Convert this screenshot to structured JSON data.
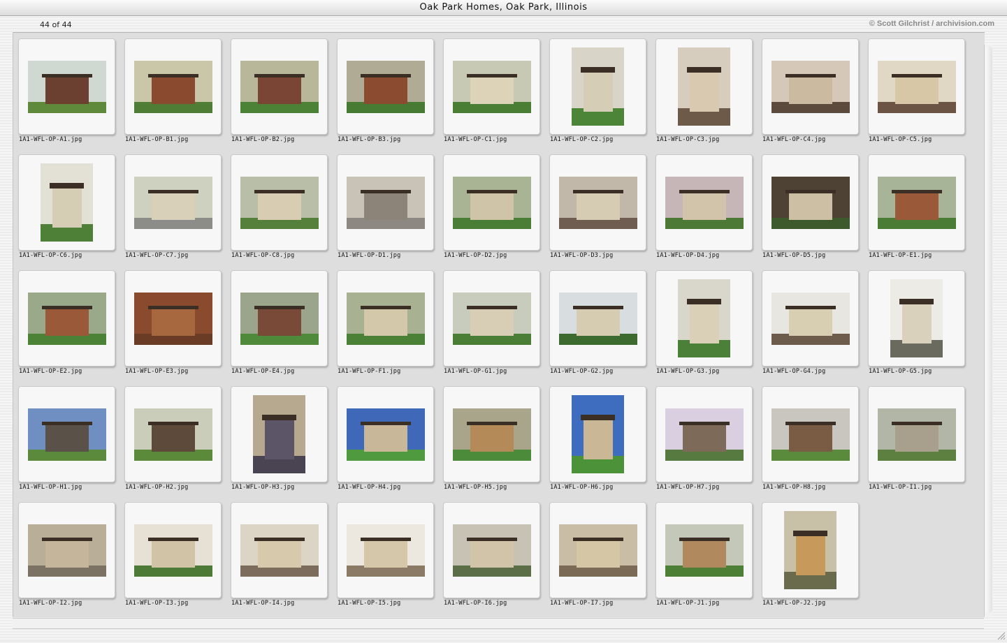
{
  "window": {
    "title": "Oak Park Homes, Oak Park, Illinois"
  },
  "header": {
    "count": "44 of 44",
    "credit": "© Scott Gilchrist / archivision.com"
  },
  "rows": [
    [
      {
        "file": "1A1-WFL-OP-A1.jpg",
        "orient": "landscape",
        "sky": "#cfd9d2",
        "wall": "#6b4030",
        "lawn": "#5f8a3b"
      },
      {
        "file": "1A1-WFL-OP-B1.jpg",
        "orient": "landscape",
        "sky": "#c9c7a8",
        "wall": "#8a4a30",
        "lawn": "#4f7d35"
      },
      {
        "file": "1A1-WFL-OP-B2.jpg",
        "orient": "landscape",
        "sky": "#b8b79a",
        "wall": "#7a4535",
        "lawn": "#4c8236"
      },
      {
        "file": "1A1-WFL-OP-B3.jpg",
        "orient": "landscape",
        "sky": "#b0ab94",
        "wall": "#8a4b30",
        "lawn": "#477a32"
      },
      {
        "file": "1A1-WFL-OP-C1.jpg",
        "orient": "landscape",
        "sky": "#c7c9b5",
        "wall": "#ddd3b8",
        "lawn": "#4a7e35"
      },
      {
        "file": "1A1-WFL-OP-C2.jpg",
        "orient": "portrait",
        "sky": "#d8d4c8",
        "wall": "#d5cdb6",
        "lawn": "#4c8538"
      },
      {
        "file": "1A1-WFL-OP-C3.jpg",
        "orient": "portrait",
        "sky": "#d6cdbf",
        "wall": "#d9c9b0",
        "lawn": "#6e5a48"
      },
      {
        "file": "1A1-WFL-OP-C4.jpg",
        "orient": "landscape",
        "sky": "#d5c8b8",
        "wall": "#cbb9a0",
        "lawn": "#5c4a3c"
      },
      {
        "file": "1A1-WFL-OP-C5.jpg",
        "orient": "landscape",
        "sky": "#e0d7c4",
        "wall": "#d8c7a6",
        "lawn": "#6b5444"
      }
    ],
    [
      {
        "file": "1A1-WFL-OP-C6.jpg",
        "orient": "portrait",
        "sky": "#e3e0d6",
        "wall": "#d6cdb5",
        "lawn": "#4f8038"
      },
      {
        "file": "1A1-WFL-OP-C7.jpg",
        "orient": "landscape",
        "sky": "#cfd1c0",
        "wall": "#d9d0ba",
        "lawn": "#8c8c88"
      },
      {
        "file": "1A1-WFL-OP-C8.jpg",
        "orient": "landscape",
        "sky": "#b9bea8",
        "wall": "#d8cdb2",
        "lawn": "#54803c"
      },
      {
        "file": "1A1-WFL-OP-D1.jpg",
        "orient": "landscape",
        "sky": "#c8c3b6",
        "wall": "#8c8478",
        "lawn": "#8d8982"
      },
      {
        "file": "1A1-WFL-OP-D2.jpg",
        "orient": "landscape",
        "sky": "#a9b495",
        "wall": "#cfc4a8",
        "lawn": "#4a7d35"
      },
      {
        "file": "1A1-WFL-OP-D3.jpg",
        "orient": "landscape",
        "sky": "#c2b8aa",
        "wall": "#d6cbb3",
        "lawn": "#6e5d50"
      },
      {
        "file": "1A1-WFL-OP-D4.jpg",
        "orient": "landscape",
        "sky": "#c6b6b7",
        "wall": "#d2c4aa",
        "lawn": "#4c7a36"
      },
      {
        "file": "1A1-WFL-OP-D5.jpg",
        "orient": "landscape",
        "sky": "#4d4234",
        "wall": "#cdbfa3",
        "lawn": "#3d5a2c"
      },
      {
        "file": "1A1-WFL-OP-E1.jpg",
        "orient": "landscape",
        "sky": "#a7b497",
        "wall": "#9a5a3a",
        "lawn": "#4b7c35"
      }
    ],
    [
      {
        "file": "1A1-WFL-OP-E2.jpg",
        "orient": "landscape",
        "sky": "#9aa98a",
        "wall": "#9a5a3a",
        "lawn": "#4c8236"
      },
      {
        "file": "1A1-WFL-OP-E3.jpg",
        "orient": "landscape",
        "sky": "#8a4a2e",
        "wall": "#a7683f",
        "lawn": "#6b3c25"
      },
      {
        "file": "1A1-WFL-OP-E4.jpg",
        "orient": "landscape",
        "sky": "#9aa58c",
        "wall": "#7a4a38",
        "lawn": "#4f8a3a"
      },
      {
        "file": "1A1-WFL-OP-F1.jpg",
        "orient": "landscape",
        "sky": "#a8b192",
        "wall": "#d4c8aa",
        "lawn": "#4b8037"
      },
      {
        "file": "1A1-WFL-OP-G1.jpg",
        "orient": "landscape",
        "sky": "#c7ccbd",
        "wall": "#d8ceb5",
        "lawn": "#4a7d35"
      },
      {
        "file": "1A1-WFL-OP-G2.jpg",
        "orient": "landscape",
        "sky": "#d8dde0",
        "wall": "#d6ccb2",
        "lawn": "#3d6a2e"
      },
      {
        "file": "1A1-WFL-OP-G3.jpg",
        "orient": "portrait",
        "sky": "#d9d6cc",
        "wall": "#d9d0b7",
        "lawn": "#4a8037"
      },
      {
        "file": "1A1-WFL-OP-G4.jpg",
        "orient": "landscape",
        "sky": "#e7e6e0",
        "wall": "#d8ceb2",
        "lawn": "#6d5c4b"
      },
      {
        "file": "1A1-WFL-OP-G5.jpg",
        "orient": "portrait",
        "sky": "#ecebe6",
        "wall": "#d9d1bc",
        "lawn": "#6a6a5e"
      }
    ],
    [
      {
        "file": "1A1-WFL-OP-H1.jpg",
        "orient": "landscape",
        "sky": "#6f8ec2",
        "wall": "#5a5248",
        "lawn": "#5c8a3c"
      },
      {
        "file": "1A1-WFL-OP-H2.jpg",
        "orient": "landscape",
        "sky": "#c9cdb9",
        "wall": "#5e4a3a",
        "lawn": "#5a8a3a"
      },
      {
        "file": "1A1-WFL-OP-H3.jpg",
        "orient": "portrait",
        "sky": "#b7a98f",
        "wall": "#5c5568",
        "lawn": "#4a4452"
      },
      {
        "file": "1A1-WFL-OP-H4.jpg",
        "orient": "landscape",
        "sky": "#3f68b8",
        "wall": "#c9b79a",
        "lawn": "#4f9a3e"
      },
      {
        "file": "1A1-WFL-OP-H5.jpg",
        "orient": "landscape",
        "sky": "#a8a58b",
        "wall": "#b38a58",
        "lawn": "#4b8b3a"
      },
      {
        "file": "1A1-WFL-OP-H6.jpg",
        "orient": "portrait",
        "sky": "#3e6cbf",
        "wall": "#c9b795",
        "lawn": "#4c9239"
      },
      {
        "file": "1A1-WFL-OP-H7.jpg",
        "orient": "landscape",
        "sky": "#d9cfe0",
        "wall": "#7d6a58",
        "lawn": "#567a40"
      },
      {
        "file": "1A1-WFL-OP-H8.jpg",
        "orient": "landscape",
        "sky": "#c9c5bf",
        "wall": "#7a5b44",
        "lawn": "#5a8a3c"
      },
      {
        "file": "1A1-WFL-OP-I1.jpg",
        "orient": "landscape",
        "sky": "#b2b6a7",
        "wall": "#a89f8c",
        "lawn": "#5d8040"
      }
    ],
    [
      {
        "file": "1A1-WFL-OP-I2.jpg",
        "orient": "landscape",
        "sky": "#b9ae97",
        "wall": "#c4b59b",
        "lawn": "#7b7263"
      },
      {
        "file": "1A1-WFL-OP-I3.jpg",
        "orient": "landscape",
        "sky": "#e6e0d5",
        "wall": "#d0c3a6",
        "lawn": "#4d7a37"
      },
      {
        "file": "1A1-WFL-OP-I4.jpg",
        "orient": "landscape",
        "sky": "#dcd5c6",
        "wall": "#d7c9ab",
        "lawn": "#7c6c5c"
      },
      {
        "file": "1A1-WFL-OP-I5.jpg",
        "orient": "landscape",
        "sky": "#ece8e0",
        "wall": "#d5c7a9",
        "lawn": "#8a7a66"
      },
      {
        "file": "1A1-WFL-OP-I6.jpg",
        "orient": "landscape",
        "sky": "#c8c2b5",
        "wall": "#d1c4a8",
        "lawn": "#5c6e48"
      },
      {
        "file": "1A1-WFL-OP-I7.jpg",
        "orient": "landscape",
        "sky": "#c9bda5",
        "wall": "#d5c7a5",
        "lawn": "#7b6a55"
      },
      {
        "file": "1A1-WFL-OP-J1.jpg",
        "orient": "landscape",
        "sky": "#c3c8b8",
        "wall": "#b08a5e",
        "lawn": "#4d8036"
      },
      {
        "file": "1A1-WFL-OP-J2.jpg",
        "orient": "portrait",
        "sky": "#c9c0a8",
        "wall": "#c79a5c",
        "lawn": "#6a6a4c"
      }
    ]
  ]
}
